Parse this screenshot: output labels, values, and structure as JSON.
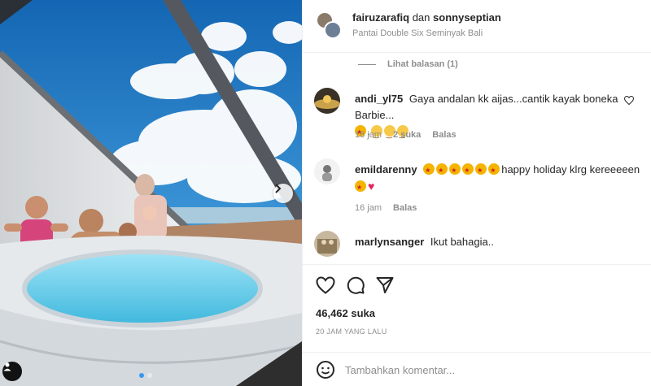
{
  "header": {
    "user1": "fairuzarafiq",
    "joiner": "dan",
    "user2": "sonnyseptian",
    "location": "Pantai Double Six Seminyak Bali"
  },
  "view_replies": "Lihat balasan (1)",
  "comments": [
    {
      "username": "andi_yl75",
      "text": "Gaya andalan kk aijas...cantik kayak boneka Barbie...",
      "time": "18 jam",
      "likes": "2 suka",
      "reply": "Balas"
    },
    {
      "username": "emildarenny",
      "text": "happy holiday klrg kereeeeen",
      "time": "16 jam",
      "reply": "Balas"
    },
    {
      "username": "marlynsanger",
      "text": "Ikut bahagia.."
    }
  ],
  "post": {
    "likes": "46,462 suka",
    "time_ago": "20 JAM YANG LALU"
  },
  "add_comment": {
    "placeholder": "Tambahkan komentar..."
  },
  "icons": {
    "like": "heart-icon",
    "comment": "comment-icon",
    "share": "send-icon",
    "emoji": "emoji-icon",
    "next": "chevron-right-icon",
    "tag": "user-tag-icon"
  },
  "colors": {
    "accent": "#3897f0",
    "secondary_text": "#8e8e8e",
    "like_red": "#e0245e"
  }
}
